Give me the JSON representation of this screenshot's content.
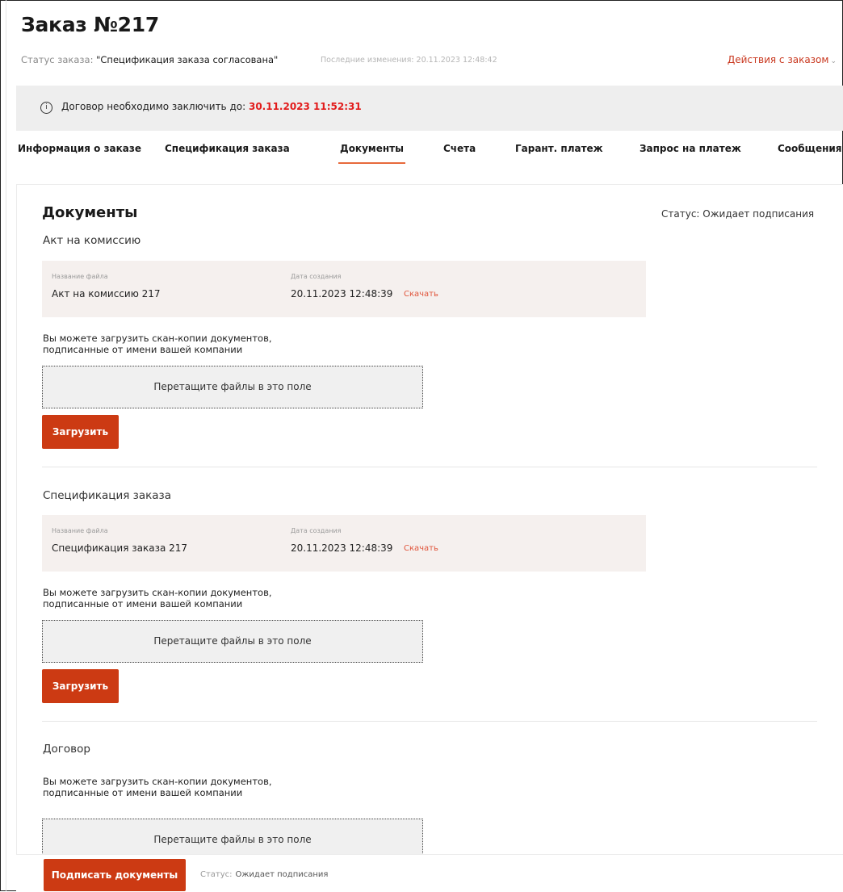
{
  "header": {
    "title": "Заказ №217",
    "status_label": "Статус заказа:",
    "status_value": "\"Спецификация заказа согласована\"",
    "last_changes": "Последние изменения: 20.11.2023 12:48:42",
    "actions_label": "Действия с заказом"
  },
  "notice": {
    "text": "Договор необходимо заключить до:",
    "deadline": "30.11.2023 11:52:31"
  },
  "tabs": [
    {
      "label": "Информация о заказе"
    },
    {
      "label": "Спецификация заказа"
    },
    {
      "label": "Документы",
      "active": true
    },
    {
      "label": "Счета"
    },
    {
      "label": "Гарант. платеж"
    },
    {
      "label": "Запрос на платеж"
    },
    {
      "label": "Сообщения"
    }
  ],
  "documents": {
    "heading": "Документы",
    "status": "Статус: Ожидает подписания",
    "file_name_label": "Название файла",
    "created_label": "Дата создания",
    "download_label": "Скачать",
    "hint_line1": "Вы можете загрузить скан-копии документов,",
    "hint_line2": "подписанные от имени вашей компании",
    "drop_label": "Перетащите файлы в это поле",
    "upload_label": "Загрузить",
    "sections": [
      {
        "title": "Акт на комиссию",
        "file_name": "Акт на комиссию 217",
        "created": "20.11.2023 12:48:39"
      },
      {
        "title": "Спецификация заказа",
        "file_name": "Спецификация заказа 217",
        "created": "20.11.2023 12:48:39"
      },
      {
        "title": "Договор"
      }
    ]
  },
  "footer": {
    "sign_label": "Подписать документы",
    "status_label": "Статус:",
    "status_value": "Ожидает подписания"
  },
  "colors": {
    "accent": "#cc3a13",
    "deadline": "#e21b1b",
    "link": "#e0543a",
    "tab_underline": "#e76a3c"
  }
}
